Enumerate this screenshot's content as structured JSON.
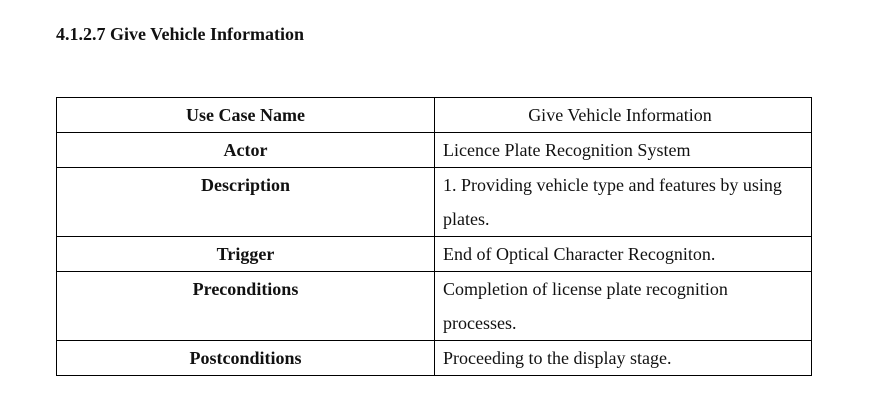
{
  "section": {
    "heading": "4.1.2.7 Give Vehicle Information"
  },
  "use_case_table": {
    "rows": [
      {
        "label": "Use Case Name",
        "value": "Give Vehicle Information"
      },
      {
        "label": "Actor",
        "value": "Licence Plate Recognition System"
      },
      {
        "label": "Description",
        "value": "1. Providing vehicle type and features by using plates."
      },
      {
        "label": "Trigger",
        "value": "End of Optical Character Recogniton."
      },
      {
        "label": "Preconditions",
        "value": "Completion of license plate recognition processes."
      },
      {
        "label": "Postconditions",
        "value": "Proceeding to the display stage."
      }
    ]
  }
}
